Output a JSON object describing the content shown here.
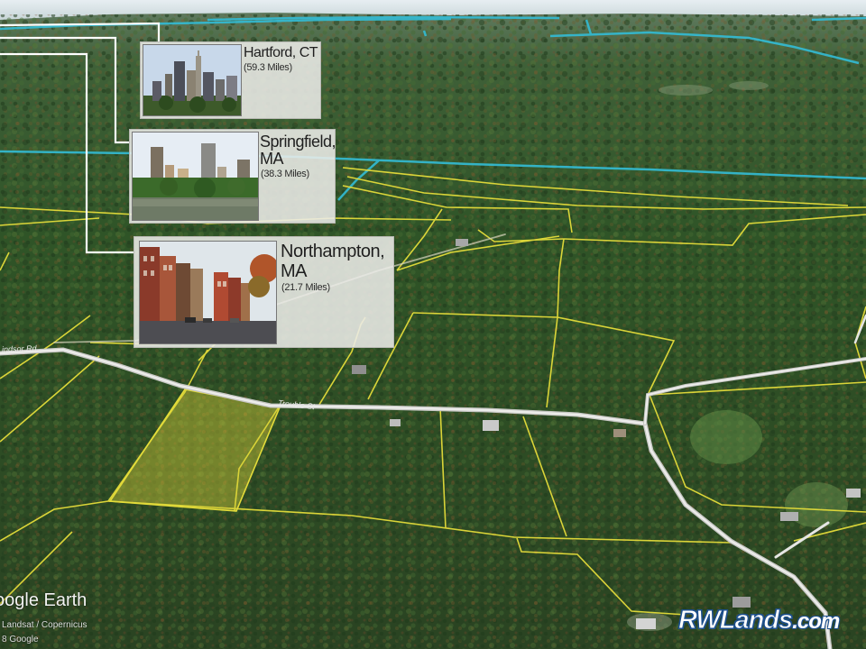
{
  "callouts": {
    "hartford": {
      "city": "Hartford, CT",
      "distance": "(59.3 Miles)"
    },
    "springfield": {
      "city_line1": "Springfield,",
      "city_line2": "MA",
      "distance": "(38.3 Miles)"
    },
    "northampton": {
      "city_line1": "Northampton,",
      "city_line2": "MA",
      "distance": "(21.7 Miles)"
    }
  },
  "streets": {
    "trouble_st": "Trouble St",
    "windsor_rd": "indsor Rd"
  },
  "footer": {
    "logo": "oogle Earth",
    "attribution_line1": "Landsat / Copernicus",
    "attribution_line2": "8 Google"
  },
  "brand": {
    "part1": "RWLands",
    "part2": ".com"
  },
  "colors": {
    "parcel_outline": "#e4dc3a",
    "highlight_fill": "#d9d23a",
    "water_lines": "#33bcd6",
    "road": "#e2e2e2",
    "callout_connector": "#ffffff",
    "brand_blue": "#1d4f8c"
  }
}
